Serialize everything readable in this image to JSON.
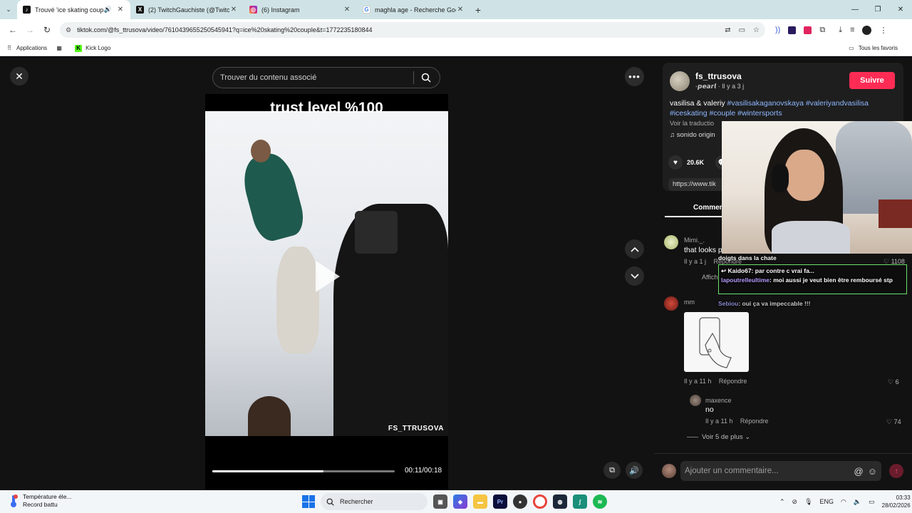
{
  "browser": {
    "tabs": [
      {
        "title": "Trouvé 'ice skating couple'",
        "favicon": "tiktok-icon",
        "active": true,
        "audio": true
      },
      {
        "title": "(2) TwitchGauchiste (@TwitchG",
        "favicon": "x-icon",
        "active": false
      },
      {
        "title": "(6) Instagram",
        "favicon": "instagram-icon",
        "active": false
      },
      {
        "title": "maghla age - Recherche Googl",
        "favicon": "google-icon",
        "active": false
      }
    ],
    "url": "tiktok.com/@fs_ttrusova/video/7610439655250545941?q=ice%20skating%20couple&t=1772235180844",
    "bookmarks": {
      "apps": "Applications",
      "kick": "Kick Logo",
      "all": "Tous les favoris"
    }
  },
  "tiktok": {
    "search_placeholder": "Trouver du contenu associé",
    "video": {
      "caption_top": "trust level %100",
      "watermark": "FS_TTRUSOVA",
      "time": "00:11/00:18",
      "progress": 0.61
    },
    "post": {
      "author": "fs_ttrusova",
      "author_sub": "-𝙥𝙚𝙖𝙧𝙡 · Il y a 3 j",
      "follow": "Suivre",
      "desc_text": "vasilisa & valeriy",
      "tags": [
        "#vasilisakaganovskaya",
        "#valeriyandvasilisa",
        "#iceskating",
        "#couple",
        "#wintersports"
      ],
      "translate": "Voir la traductio",
      "sound": "♫  sonido origin",
      "likes": "20.6K",
      "link": "https://www.tik",
      "comments_tab": "Commen"
    },
    "comments": [
      {
        "name": "Mimi._.",
        "text": "that looks p",
        "meta": "Il y a 1 j",
        "reply": "Répondre",
        "likes": "1108",
        "extra": "Affich"
      },
      {
        "name": "mm",
        "meta": "Il y a 11 h",
        "reply": "Répondre",
        "likes": "6"
      },
      {
        "name": "maxence",
        "text": "no",
        "meta": "Il y a 11 h",
        "reply": "Répondre",
        "likes": "74"
      }
    ],
    "see_more": "Voir 5 de plus",
    "comment_placeholder": "Ajouter un commentaire..."
  },
  "stream_overlay": {
    "chat_line_1": "doigts dans la chate",
    "chat_line_2": "Kaido67: par contre c vrai fa...",
    "chat_line_3_user": "lapoutrelleultime",
    "chat_line_3_msg": ": moi aussi je veut bien être remboursé stp",
    "chat_line_4_user": "Sebiou",
    "chat_line_4_msg": ": oui ça va impeccable !!!"
  },
  "taskbar": {
    "weather_title": "Température éle...",
    "weather_sub": "Record battu",
    "search": "Rechercher",
    "lang": "ENG",
    "time": "03:33",
    "date": "28/02/2026"
  },
  "colors": {
    "follow": "#fe2c55",
    "hashtag": "#8fb8ff",
    "tabbar": "#cfe3e6"
  }
}
